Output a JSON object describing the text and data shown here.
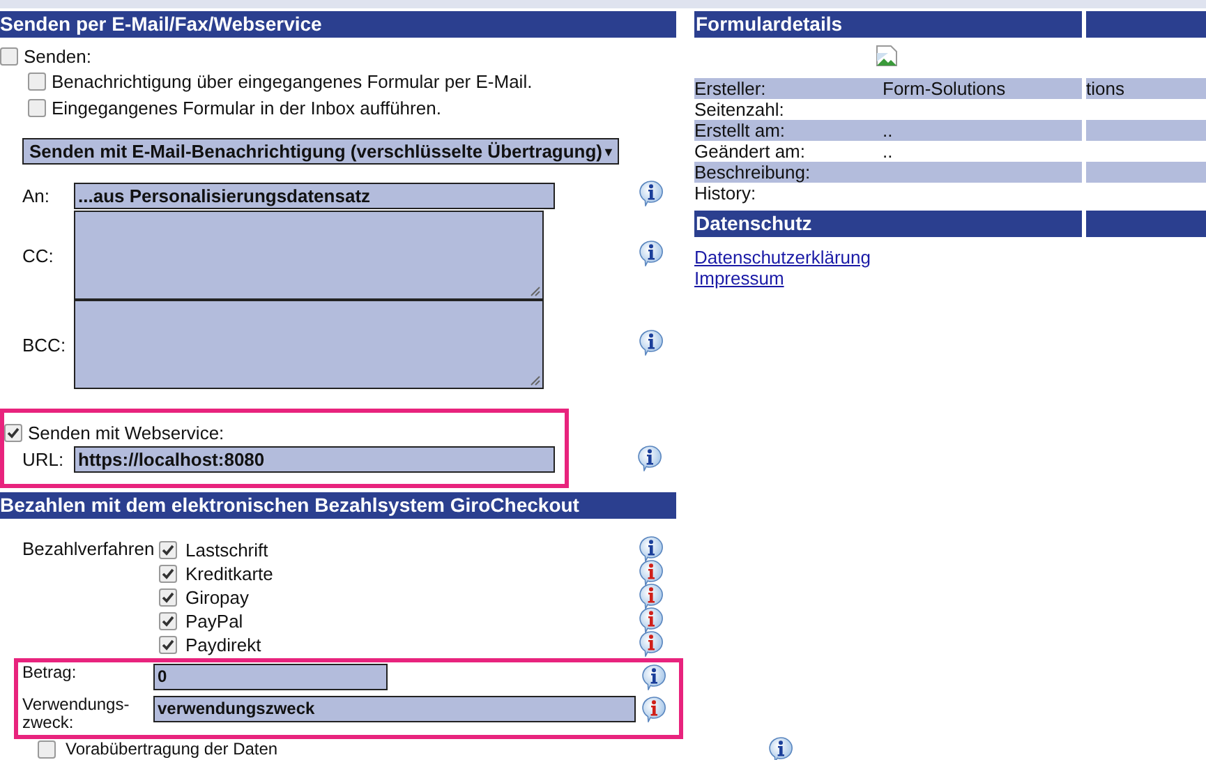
{
  "email_section": {
    "title": "Senden per E-Mail/Fax/Webservice",
    "send": {
      "label": "Senden:",
      "checked": false
    },
    "options": [
      {
        "label": "Benachrichtigung über eingegangenes Formular per E-Mail.",
        "checked": false
      },
      {
        "label": "Eingegangenes Formular in der Inbox aufführen.",
        "checked": false
      }
    ],
    "mode_select": {
      "value": "Senden mit E-Mail-Benachrichtigung (verschlüsselte Übertragung)",
      "arrow": "▼"
    },
    "recipients": [
      {
        "kind": "input",
        "label": "An:",
        "value": "...aus Personalisierungsdatensatz",
        "info_icon": {
          "color": "#1b3f9a"
        }
      },
      {
        "kind": "textarea",
        "label": "CC:",
        "info_icon": {
          "color": "#1b3f9a"
        }
      },
      {
        "kind": "textarea",
        "label": "BCC:",
        "info_icon": {
          "color": "#1b3f9a"
        }
      }
    ],
    "webservice": {
      "highlighted": true,
      "label": "Senden mit Webservice:",
      "checked": true,
      "url_label": "URL:",
      "url": "https://localhost:8080",
      "info_icon": {
        "color": "#1b3f9a"
      }
    }
  },
  "payment_section": {
    "title": "Bezahlen mit dem elektronischen Bezahlsystem GiroCheckout",
    "methods_label": "Bezahlverfahren",
    "methods": [
      {
        "label": "Lastschrift",
        "checked": true,
        "info_icon": {
          "color": "#1b3f9a"
        }
      },
      {
        "label": "Kreditkarte",
        "checked": true,
        "info_icon": {
          "color": "#d0201a"
        }
      },
      {
        "label": "Giropay",
        "checked": true,
        "info_icon": {
          "color": "#d0201a"
        }
      },
      {
        "label": "PayPal",
        "checked": true,
        "info_icon": {
          "color": "#d0201a"
        }
      },
      {
        "label": "Paydirekt",
        "checked": true,
        "info_icon": {
          "color": "#d0201a"
        }
      }
    ],
    "amount_group": {
      "highlighted": true,
      "fields": [
        {
          "label": "Betrag:",
          "value": "0",
          "info_icon": {
            "color": "#1b3f9a"
          }
        },
        {
          "label": "Verwendungs-zweck:",
          "value": "verwendungszweck",
          "info_icon": {
            "color": "#d0201a"
          }
        }
      ]
    },
    "prefetch": {
      "label": "Vorabübertragung der Daten",
      "checked": false,
      "info_icon": {
        "color": "#1b3f9a"
      }
    }
  },
  "details": {
    "title": "Formulardetails",
    "rows": [
      {
        "label": "Ersteller:",
        "value": "Form-Solutions",
        "extra": "tions"
      },
      {
        "label": "Seitenzahl:"
      },
      {
        "label": "Erstellt am:",
        "value": ".."
      },
      {
        "label": "Geändert am:",
        "value": ".."
      },
      {
        "label": "Beschreibung:"
      },
      {
        "label": "History:"
      }
    ]
  },
  "privacy": {
    "title": "Datenschutz",
    "links": [
      "Datenschutzerklärung",
      "Impressum"
    ]
  }
}
